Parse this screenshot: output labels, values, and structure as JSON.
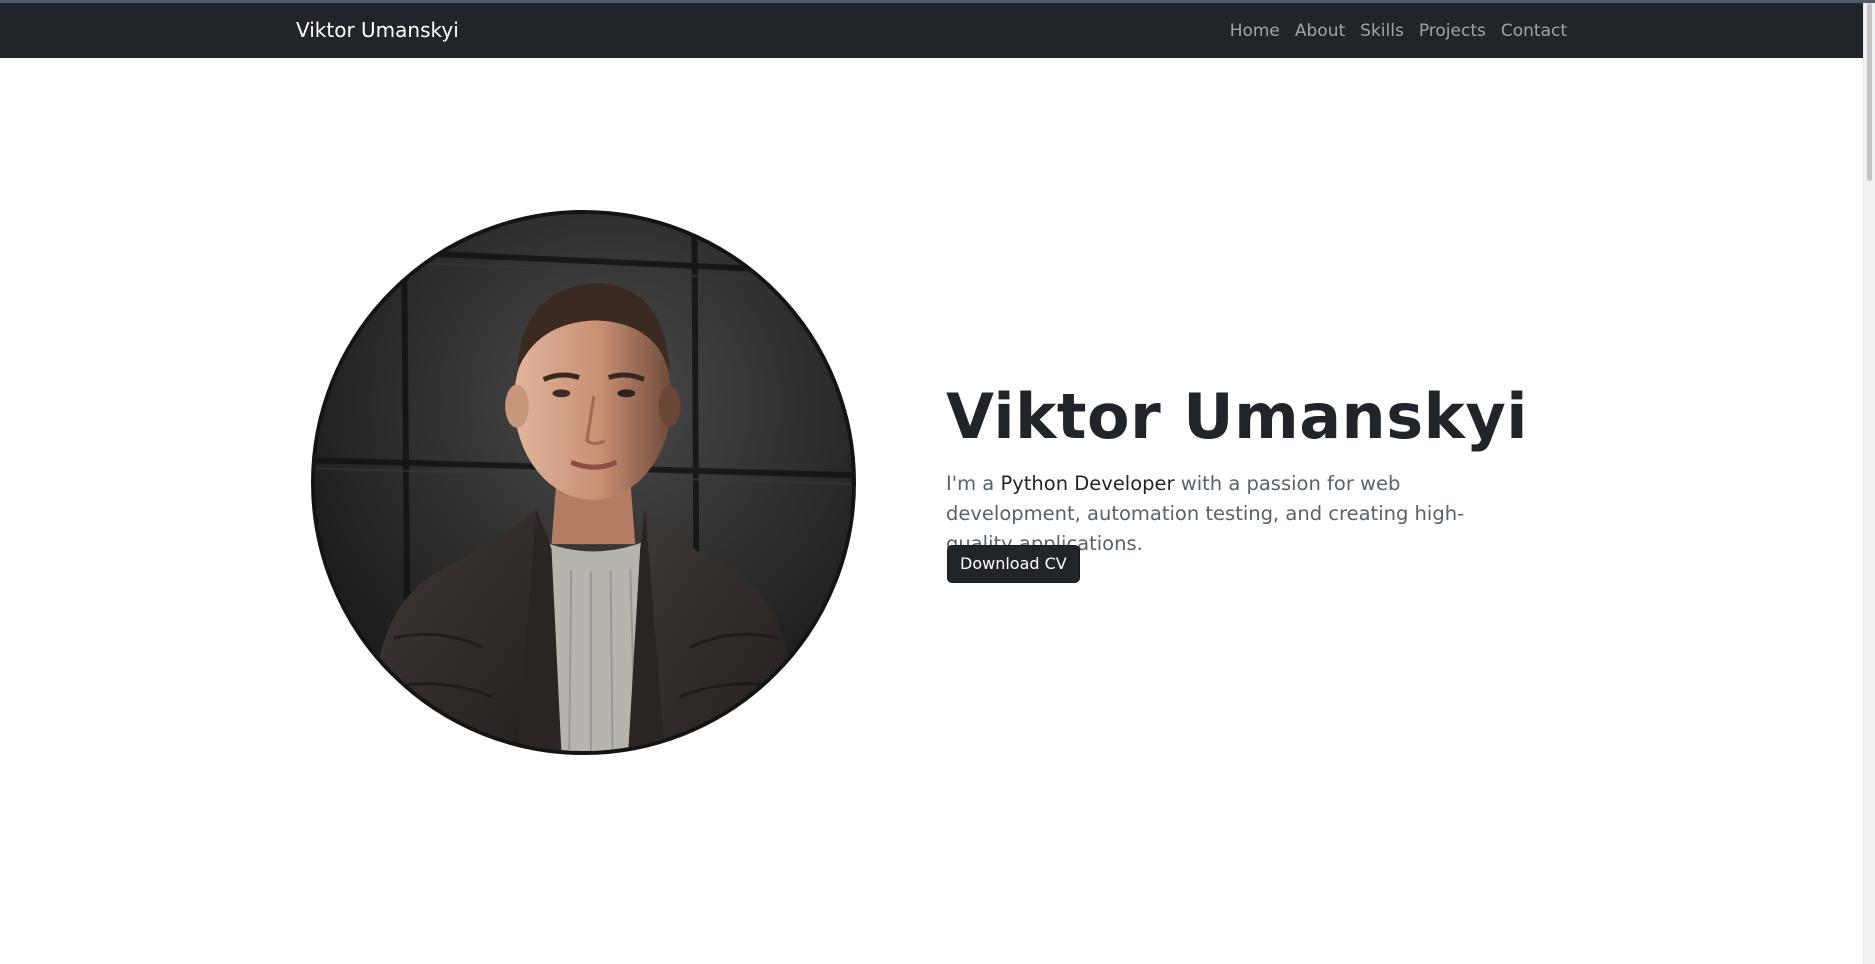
{
  "navbar": {
    "brand": "Viktor Umanskyi",
    "links": [
      "Home",
      "About",
      "Skills",
      "Projects",
      "Contact"
    ]
  },
  "hero": {
    "title": "Viktor Umanskyi",
    "intro_prefix": "I'm a ",
    "intro_role": "Python Developer",
    "intro_suffix": " with a passion for web development, automation testing, and creating high-quality applications.",
    "download_label": "Download CV"
  },
  "colors": {
    "navbar_background": "#212529",
    "nav_link": "#9ea4aa",
    "heading": "#212529",
    "body_text": "#5a6168",
    "button_background": "#212529"
  },
  "icons": [
    "profile-photo"
  ]
}
